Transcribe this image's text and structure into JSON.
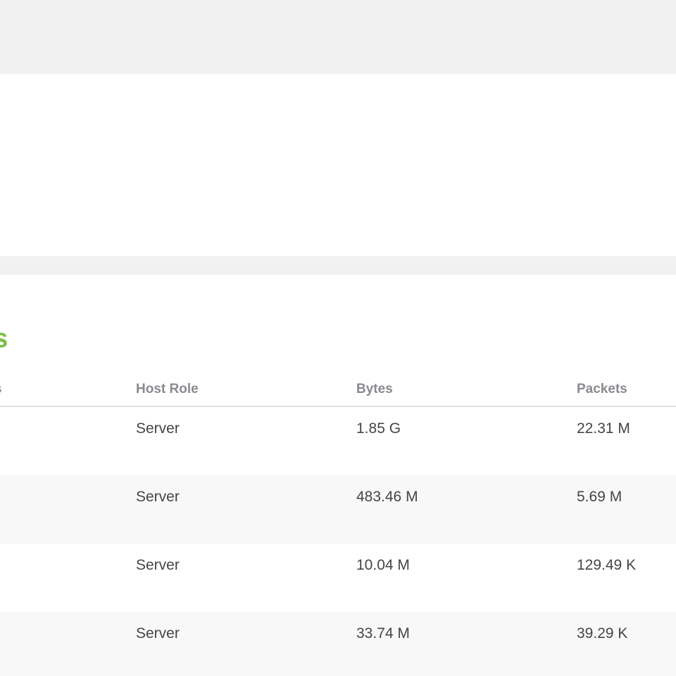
{
  "section": {
    "title": "rs"
  },
  "table": {
    "headers": {
      "clipped": "s",
      "host_role": "Host Role",
      "bytes": "Bytes",
      "packets": "Packets"
    },
    "rows": [
      {
        "host_role": "Server",
        "bytes": "1.85 G",
        "packets": "22.31 M"
      },
      {
        "host_role": "Server",
        "bytes": "483.46 M",
        "packets": "5.69 M"
      },
      {
        "host_role": "Server",
        "bytes": "10.04 M",
        "packets": "129.49 K"
      },
      {
        "host_role": "Server",
        "bytes": "33.74 M",
        "packets": "39.29 K"
      }
    ]
  },
  "colors": {
    "page_background": "#f1f1f1",
    "panel_background": "#ffffff",
    "title_accent": "#7bbf44",
    "header_text": "#8a8a8f",
    "cell_text": "#454545",
    "alt_row": "#f8f8f8",
    "divider": "#dedede"
  }
}
